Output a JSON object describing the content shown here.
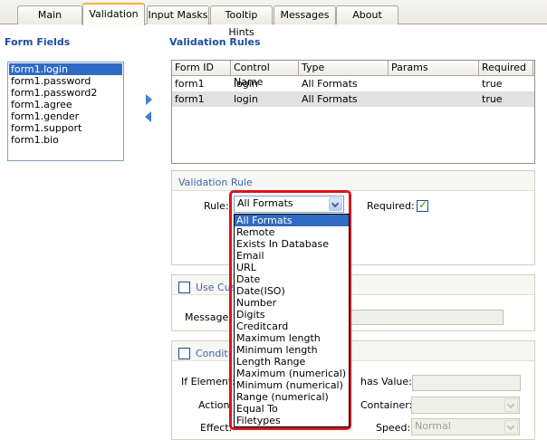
{
  "tabs": [
    {
      "label": "Main"
    },
    {
      "label": "Validation"
    },
    {
      "label": "Input Masks"
    },
    {
      "label": "Tooltip Hints"
    },
    {
      "label": "Messages"
    },
    {
      "label": "About"
    }
  ],
  "form_fields": {
    "title": "Form Fields",
    "items": [
      "form1.login",
      "form1.password",
      "form1.password2",
      "form1.agree",
      "form1.gender",
      "form1.support",
      "form1.bio"
    ]
  },
  "validation_rules": {
    "title": "Validation Rules",
    "columns": [
      "Form ID",
      "Control Name",
      "Type",
      "Params",
      "Required"
    ],
    "rows": [
      [
        "form1",
        "login",
        "All Formats",
        "",
        "true"
      ],
      [
        "form1",
        "login",
        "All Formats",
        "",
        "true"
      ]
    ]
  },
  "validation_rule": {
    "title": "Validation Rule",
    "rule_label": "Rule:",
    "rule_value": "All Formats",
    "required_label": "Required:",
    "options": [
      "All Formats",
      "Remote",
      "Exists In Database",
      "Email",
      "URL",
      "Date",
      "Date(ISO)",
      "Number",
      "Digits",
      "Creditcard",
      "Maximum length",
      "Minimum length",
      "Length Range",
      "Maximum (numerical)",
      "Minimum (numerical)",
      "Range (numerical)",
      "Equal To",
      "Filetypes"
    ]
  },
  "use_custom": {
    "title": "Use Cus",
    "message_label": "Message:"
  },
  "condition": {
    "title": "Conditi",
    "if_element_label": "If Element:",
    "has_value_label": "has Value:",
    "action_label": "Action:",
    "container_label": "Container:",
    "effect_label": "Effect:",
    "speed_label": "Speed:",
    "speed_value": "Normal"
  },
  "colors": {
    "accent": "#1f4fa0",
    "highlight": "#d9161c",
    "selection": "#316ac5"
  }
}
